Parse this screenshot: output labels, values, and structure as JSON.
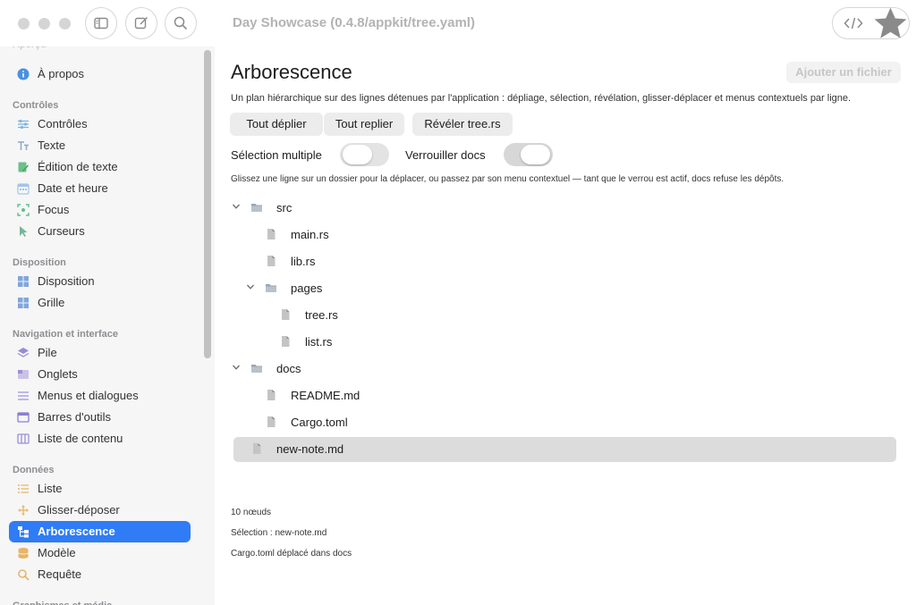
{
  "window": {
    "title": "Day Showcase (0.4.8/appkit/tree.yaml)"
  },
  "sidebar": {
    "sections": [
      {
        "title": "Aperçu",
        "items": [
          {
            "label": "À propos",
            "icon": "info-icon",
            "color": "#4a90e2"
          }
        ]
      },
      {
        "title": "Contrôles",
        "items": [
          {
            "label": "Contrôles",
            "icon": "sliders-icon",
            "color": "#7fb3e0"
          },
          {
            "label": "Texte",
            "icon": "text-icon",
            "color": "#8aa9c7"
          },
          {
            "label": "Édition de texte",
            "icon": "edit-icon",
            "color": "#6cc08a"
          },
          {
            "label": "Date et heure",
            "icon": "calendar-icon",
            "color": "#a3c5e5"
          },
          {
            "label": "Focus",
            "icon": "focus-icon",
            "color": "#5fbf8f"
          },
          {
            "label": "Curseurs",
            "icon": "cursor-icon",
            "color": "#74b79a"
          }
        ]
      },
      {
        "title": "Disposition",
        "items": [
          {
            "label": "Disposition",
            "icon": "layout-icon",
            "color": "#7fa7dc"
          },
          {
            "label": "Grille",
            "icon": "grid-icon",
            "color": "#7fa7dc"
          }
        ]
      },
      {
        "title": "Navigation et interface",
        "items": [
          {
            "label": "Pile",
            "icon": "stack-icon",
            "color": "#9b8ad6"
          },
          {
            "label": "Onglets",
            "icon": "tabs-icon",
            "color": "#a18ed8"
          },
          {
            "label": "Menus et dialogues",
            "icon": "menu-icon",
            "color": "#a99be0"
          },
          {
            "label": "Barres d'outils",
            "icon": "toolbar-icon",
            "color": "#8c7fd2"
          },
          {
            "label": "Liste de contenu",
            "icon": "columns-icon",
            "color": "#9a8fd8"
          }
        ]
      },
      {
        "title": "Données",
        "items": [
          {
            "label": "Liste",
            "icon": "list-icon",
            "color": "#e6b56a"
          },
          {
            "label": "Glisser-déposer",
            "icon": "move-icon",
            "color": "#e6b56a"
          },
          {
            "label": "Arborescence",
            "icon": "tree-icon",
            "color": "#ffffff",
            "selected": true
          },
          {
            "label": "Modèle",
            "icon": "database-icon",
            "color": "#e6b56a"
          },
          {
            "label": "Requête",
            "icon": "search-icon",
            "color": "#e6b56a"
          }
        ]
      },
      {
        "title": "Graphismes et média",
        "items": []
      }
    ]
  },
  "main": {
    "title": "Arborescence",
    "add_button": "Ajouter un fichier",
    "description": "Un plan hiérarchique sur des lignes détenues par l'application : dépliage, sélection, révélation, glisser-déplacer et menus contextuels par ligne.",
    "buttons": {
      "expand": "Tout déplier",
      "collapse": "Tout replier",
      "reveal": "Révéler tree.rs"
    },
    "toggles": {
      "multi_label": "Sélection multiple",
      "multi_on": false,
      "lock_label": "Verrouiller docs",
      "lock_on": true
    },
    "hint": "Glissez une ligne sur un dossier pour la déplacer, ou passez par son menu contextuel — tant que le verrou est actif, docs refuse les dépôts.",
    "tree": [
      {
        "name": "src",
        "type": "folder",
        "depth": 0,
        "expanded": true
      },
      {
        "name": "main.rs",
        "type": "file",
        "depth": 1
      },
      {
        "name": "lib.rs",
        "type": "file",
        "depth": 1
      },
      {
        "name": "pages",
        "type": "folder",
        "depth": 1,
        "expanded": true
      },
      {
        "name": "tree.rs",
        "type": "file",
        "depth": 2
      },
      {
        "name": "list.rs",
        "type": "file",
        "depth": 2
      },
      {
        "name": "docs",
        "type": "folder",
        "depth": 0,
        "expanded": true
      },
      {
        "name": "README.md",
        "type": "file",
        "depth": 1
      },
      {
        "name": "Cargo.toml",
        "type": "file",
        "depth": 1
      },
      {
        "name": "new-note.md",
        "type": "file",
        "depth": 0,
        "selected": true
      }
    ],
    "status": {
      "count": "10 nœuds",
      "selection": "Sélection : new-note.md",
      "last_action": "Cargo.toml déplacé dans docs"
    }
  }
}
